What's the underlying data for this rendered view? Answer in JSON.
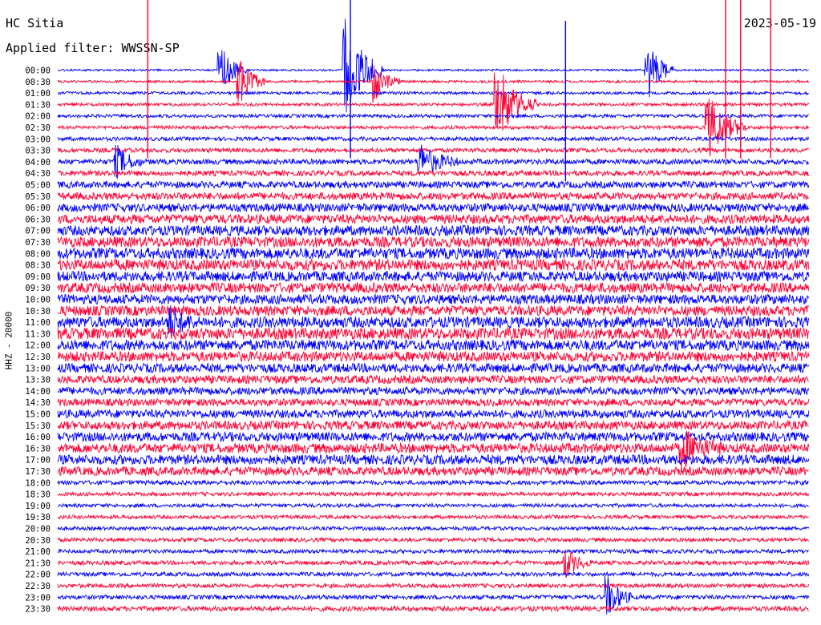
{
  "header": {
    "station": "HC Sitia",
    "filter_label": "Applied filter: WWSSN-SP",
    "date": "2023-05-19"
  },
  "chart_data": {
    "type": "line",
    "title": "HC Sitia",
    "subtitle": "Applied filter: WWSSN-SP",
    "date": "2023-05-19",
    "ylabel": "HHZ - 20000",
    "x_range_minutes": [
      0,
      30
    ],
    "rows": [
      "00:00",
      "00:30",
      "01:00",
      "01:30",
      "02:00",
      "02:30",
      "03:00",
      "03:30",
      "04:00",
      "04:30",
      "05:00",
      "05:30",
      "06:00",
      "06:30",
      "07:00",
      "07:30",
      "08:00",
      "08:30",
      "09:00",
      "09:30",
      "10:00",
      "10:30",
      "11:00",
      "11:30",
      "12:00",
      "12:30",
      "13:00",
      "13:30",
      "14:00",
      "14:30",
      "15:00",
      "15:30",
      "16:00",
      "16:30",
      "17:00",
      "17:30",
      "18:00",
      "18:30",
      "19:00",
      "19:30",
      "20:00",
      "20:30",
      "21:00",
      "21:30",
      "22:00",
      "22:30",
      "23:00",
      "23:30"
    ],
    "row_colors": [
      "#0000ff",
      "#ff0033"
    ],
    "grid": false,
    "relative_amplitude": [
      0.08,
      0.1,
      0.12,
      0.12,
      0.14,
      0.14,
      0.16,
      0.18,
      0.22,
      0.22,
      0.28,
      0.3,
      0.34,
      0.38,
      0.42,
      0.44,
      0.46,
      0.46,
      0.42,
      0.42,
      0.4,
      0.42,
      0.46,
      0.48,
      0.44,
      0.42,
      0.38,
      0.34,
      0.32,
      0.3,
      0.34,
      0.36,
      0.38,
      0.4,
      0.4,
      0.36,
      0.18,
      0.16,
      0.15,
      0.15,
      0.15,
      0.16,
      0.16,
      0.17,
      0.17,
      0.17,
      0.18,
      0.2
    ],
    "events": [
      {
        "row": 0,
        "minute": 6.5,
        "amplitude": 2.2,
        "duration_min": 1.0
      },
      {
        "row": 0,
        "minute": 11.5,
        "amplitude": 4.2,
        "duration_min": 1.5
      },
      {
        "row": 0,
        "minute": 23.6,
        "amplitude": 2.5,
        "duration_min": 1.0
      },
      {
        "row": 1,
        "minute": 7.3,
        "amplitude": 2.0,
        "duration_min": 1.0
      },
      {
        "row": 1,
        "minute": 12.7,
        "amplitude": 1.7,
        "duration_min": 1.0
      },
      {
        "row": 3,
        "minute": 17.6,
        "amplitude": 3.2,
        "duration_min": 1.5
      },
      {
        "row": 5,
        "minute": 26.0,
        "amplitude": 2.6,
        "duration_min": 1.5
      },
      {
        "row": 8,
        "minute": 14.5,
        "amplitude": 1.4,
        "duration_min": 1.5
      },
      {
        "row": 8,
        "minute": 2.4,
        "amplitude": 1.2,
        "duration_min": 1.0
      },
      {
        "row": 22,
        "minute": 4.5,
        "amplitude": 1.2,
        "duration_min": 1.0
      },
      {
        "row": 33,
        "minute": 25.0,
        "amplitude": 1.5,
        "duration_min": 1.5
      },
      {
        "row": 43,
        "minute": 20.3,
        "amplitude": 1.2,
        "duration_min": 1.0
      },
      {
        "row": 46,
        "minute": 22.0,
        "amplitude": 1.6,
        "duration_min": 1.0
      }
    ],
    "clipped_spikes": [
      {
        "row": 0,
        "minute": 3.6,
        "color": "#ff0033"
      },
      {
        "row": 0,
        "minute": 11.7,
        "color": "#0000ff"
      },
      {
        "row": 0,
        "minute": 26.7,
        "color": "#ff0033"
      },
      {
        "row": 0,
        "minute": 27.3,
        "color": "#ff0033"
      },
      {
        "row": 0,
        "minute": 28.5,
        "color": "#ff0033"
      },
      {
        "row": 2,
        "minute": 20.3,
        "color": "#0000ff"
      }
    ]
  }
}
